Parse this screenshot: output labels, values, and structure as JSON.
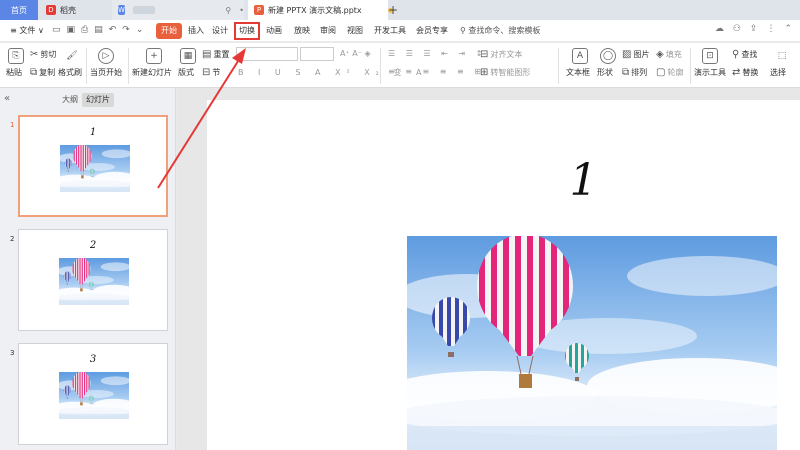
{
  "titlebar": {
    "home": "首页",
    "daoke": "稻壳",
    "doc_tab": "新建 PPTX 演示文稿.pptx",
    "add": "+"
  },
  "menubar": {
    "file": "≡ 文件 ∨",
    "tabs": [
      "开始",
      "插入",
      "设计",
      "切换",
      "动画",
      "放映",
      "审阅",
      "视图",
      "开发工具",
      "会员专享"
    ],
    "active_tab": "开始",
    "highlighted_tab": "切换",
    "search": "查找命令、搜索模板"
  },
  "ribbon": {
    "paste": "粘贴",
    "cut": "剪切",
    "copy": "复制",
    "format_painter": "格式刷",
    "from_current": "当页开始",
    "new_slide": "新建幻灯片",
    "layout": "版式",
    "section": "节",
    "reset": "重置",
    "align_text": "对齐文本",
    "smartart": "转智能图形",
    "textbox": "文本框",
    "shape": "形状",
    "arrange": "排列",
    "picture": "图片",
    "fill": "填充",
    "outline": "轮廓",
    "present_tools": "演示工具",
    "find": "查找",
    "replace": "替换",
    "select": "选择"
  },
  "panel": {
    "outline_tab": "大纲",
    "slides_tab": "幻灯片",
    "slides": [
      {
        "index": "1",
        "title": "1"
      },
      {
        "index": "2",
        "title": "2"
      },
      {
        "index": "3",
        "title": "3"
      }
    ]
  },
  "main_slide": {
    "title": "1"
  },
  "colors": {
    "accent": "#e8603c",
    "highlight_box": "#e53935",
    "home_tab": "#5b86e5"
  }
}
